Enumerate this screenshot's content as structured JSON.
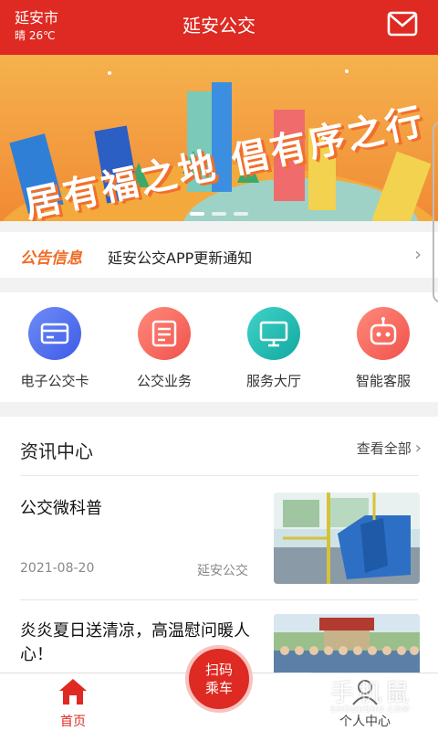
{
  "header": {
    "city": "延安市",
    "weather": "晴 26℃",
    "title": "延安公交",
    "mail_icon": "mail-icon"
  },
  "banner": {
    "slogan": "居有福之地 倡有序之行",
    "slide_count": 3,
    "active_slide": 1
  },
  "notice": {
    "tag": "公告信息",
    "text": "延安公交APP更新通知",
    "chevron": "›"
  },
  "quick_actions": [
    {
      "label": "电子公交卡",
      "icon": "card-icon",
      "color": "#4a6cf0"
    },
    {
      "label": "公交业务",
      "icon": "business-icon",
      "color": "#f05a54"
    },
    {
      "label": "服务大厅",
      "icon": "monitor-icon",
      "color": "#1ab8b0"
    },
    {
      "label": "智能客服",
      "icon": "robot-icon",
      "color": "#f35e58"
    }
  ],
  "news": {
    "heading": "资讯中心",
    "view_all": "查看全部",
    "chevron": "›",
    "items": [
      {
        "title": "公交微科普",
        "date": "2021-08-20",
        "source": "延安公交",
        "thumb": "bus-interior-photo"
      },
      {
        "title": "炎炎夏日送清凉，高温慰问暖人心！",
        "thumb": "group-photo"
      }
    ]
  },
  "tabbar": {
    "home": "首页",
    "scan_line1": "扫码",
    "scan_line2": "乘车",
    "profile": "个人中心"
  },
  "watermark": {
    "text": "手机鼠",
    "sub": "SHOUJISHU.COM"
  },
  "colors": {
    "brand_red": "#de2a22",
    "notice_orange": "#f06a22"
  }
}
